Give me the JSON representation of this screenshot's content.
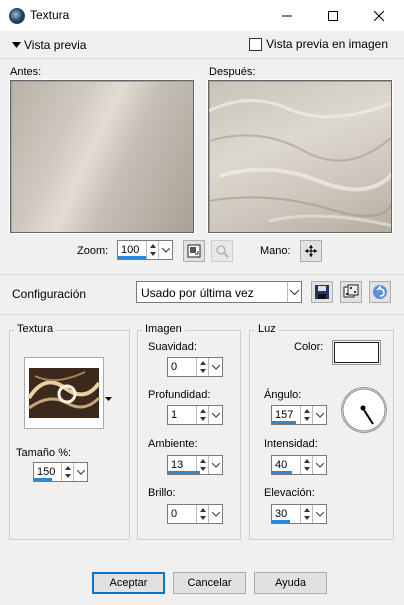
{
  "window": {
    "title": "Textura"
  },
  "preview": {
    "toggle_label": "Vista previa",
    "in_image_label": "Vista previa en imagen",
    "in_image_checked": false,
    "before_label": "Antes:",
    "after_label": "Después:",
    "zoom_label": "Zoom:",
    "zoom_value": "100",
    "pan_label": "Mano:"
  },
  "config": {
    "label": "Configuración",
    "preset_value": "Usado por última vez"
  },
  "texture_group": {
    "title": "Textura",
    "size_label": "Tamaño %:",
    "size_value": "150",
    "thumbnail_icon": "swirl-texture-thumbnail"
  },
  "image_group": {
    "title": "Imagen",
    "softness_label": "Suavidad:",
    "softness_value": "0",
    "depth_label": "Profundidad:",
    "depth_value": "1",
    "ambient_label": "Ambiente:",
    "ambient_value": "13",
    "brightness_label": "Brillo:",
    "brightness_value": "0"
  },
  "light_group": {
    "title": "Luz",
    "color_label": "Color:",
    "color_value": "#ffffff",
    "angle_label": "Ángulo:",
    "angle_value": "157",
    "intensity_label": "Intensidad:",
    "intensity_value": "40",
    "elevation_label": "Elevación:",
    "elevation_value": "30"
  },
  "buttons": {
    "accept": "Aceptar",
    "cancel": "Cancelar",
    "help": "Ayuda"
  },
  "colors": {
    "accent": "#2f86d6",
    "dialog_bg": "#f0f0f0"
  }
}
